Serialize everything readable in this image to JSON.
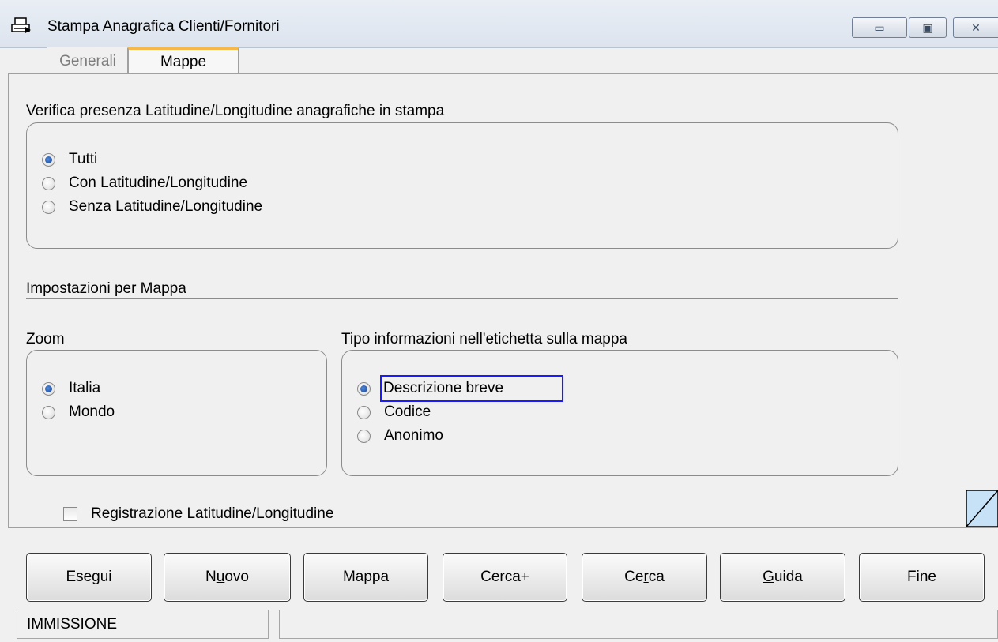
{
  "window": {
    "title": "Stampa Anagrafica Clienti/Fornitori",
    "minimize_label": "▭",
    "maximize_label": "▣",
    "close_label": "✕"
  },
  "tabs": [
    {
      "label": "Generali",
      "active": false
    },
    {
      "label": "Mappe",
      "active": true
    }
  ],
  "verifica": {
    "title": "Verifica presenza Latitudine/Longitudine anagrafiche in stampa",
    "options": [
      {
        "label": "Tutti",
        "checked": true
      },
      {
        "label": "Con Latitudine/Longitudine",
        "checked": false
      },
      {
        "label": "Senza Latitudine/Longitudine",
        "checked": false
      }
    ]
  },
  "impostazioni": {
    "title": "Impostazioni per Mappa"
  },
  "zoom": {
    "title": "Zoom",
    "options": [
      {
        "label": "Italia",
        "checked": true
      },
      {
        "label": "Mondo",
        "checked": false
      }
    ]
  },
  "tipo_info": {
    "title": "Tipo informazioni nell'etichetta sulla mappa",
    "options": [
      {
        "label": "Descrizione breve",
        "checked": true
      },
      {
        "label": "Codice",
        "checked": false
      },
      {
        "label": "Anonimo",
        "checked": false
      }
    ]
  },
  "registrazione": {
    "label": "Registrazione Latitudine/Longitudine",
    "checked": false
  },
  "buttons": {
    "esegui": "Esegui",
    "nuovo_pre": "N",
    "nuovo_u": "u",
    "nuovo_post": "ovo",
    "mappa": "Mappa",
    "cerca_plus": "Cerca+",
    "cerca_pre": "Ce",
    "cerca_u": "r",
    "cerca_post": "ca",
    "guida_u": "G",
    "guida_post": "uida",
    "fine": "Fine"
  },
  "status": {
    "mode": "IMMISSIONE",
    "message": ""
  },
  "colors": {
    "tab_accent": "#f5b849",
    "focus_border": "#1a1aff",
    "radio_fill": "#1f4fa3"
  }
}
